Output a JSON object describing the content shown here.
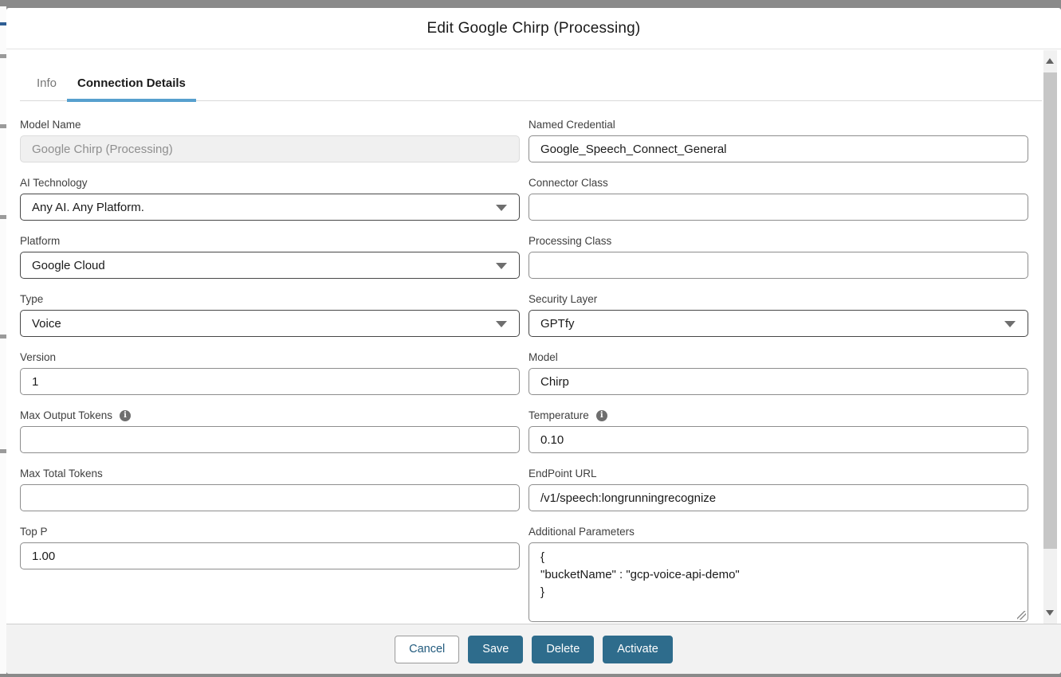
{
  "modal": {
    "title": "Edit Google Chirp (Processing)",
    "tabs": [
      {
        "label": "Info",
        "active": false
      },
      {
        "label": "Connection Details",
        "active": true
      }
    ],
    "form": {
      "left": [
        {
          "label": "Model Name",
          "control": "text",
          "value": "Google Chirp (Processing)",
          "disabled": true,
          "info": false
        },
        {
          "label": "AI Technology",
          "control": "select",
          "value": "Any AI. Any Platform.",
          "disabled": false,
          "info": false
        },
        {
          "label": "Platform",
          "control": "select",
          "value": "Google Cloud",
          "disabled": false,
          "info": false
        },
        {
          "label": "Type",
          "control": "select",
          "value": "Voice",
          "disabled": false,
          "info": false
        },
        {
          "label": "Version",
          "control": "text",
          "value": "1",
          "disabled": false,
          "info": false
        },
        {
          "label": "Max Output Tokens",
          "control": "text",
          "value": "",
          "disabled": false,
          "info": true
        },
        {
          "label": "Max Total Tokens",
          "control": "text",
          "value": "",
          "disabled": false,
          "info": false
        },
        {
          "label": "Top P",
          "control": "text",
          "value": "1.00",
          "disabled": false,
          "info": false
        }
      ],
      "right": [
        {
          "label": "Named Credential",
          "control": "text",
          "value": "Google_Speech_Connect_General",
          "disabled": false,
          "info": false
        },
        {
          "label": "Connector Class",
          "control": "text",
          "value": "",
          "disabled": false,
          "info": false
        },
        {
          "label": "Processing Class",
          "control": "text",
          "value": "",
          "disabled": false,
          "info": false
        },
        {
          "label": "Security Layer",
          "control": "select",
          "value": "GPTfy",
          "disabled": false,
          "info": false
        },
        {
          "label": "Model",
          "control": "text",
          "value": "Chirp",
          "disabled": false,
          "info": false
        },
        {
          "label": "Temperature",
          "control": "text",
          "value": "0.10",
          "disabled": false,
          "info": true
        },
        {
          "label": "EndPoint URL",
          "control": "text",
          "value": "/v1/speech:longrunningrecognize",
          "disabled": false,
          "info": false
        },
        {
          "label": "Additional Parameters",
          "control": "textarea",
          "value": "{\n\"bucketName\" : \"gcp-voice-api-demo\"\n}",
          "disabled": false,
          "info": false
        }
      ]
    },
    "footer": {
      "buttons": [
        {
          "label": "Cancel",
          "variant": "secondary"
        },
        {
          "label": "Save",
          "variant": "primary"
        },
        {
          "label": "Delete",
          "variant": "primary"
        },
        {
          "label": "Activate",
          "variant": "primary"
        }
      ]
    }
  },
  "icons": {
    "info": "i"
  },
  "colors": {
    "tab_underline": "#57a0ce",
    "primary_button": "#2e6c8c",
    "cancel_text": "#215a7d",
    "page_backdrop": "#8a8a8a"
  }
}
